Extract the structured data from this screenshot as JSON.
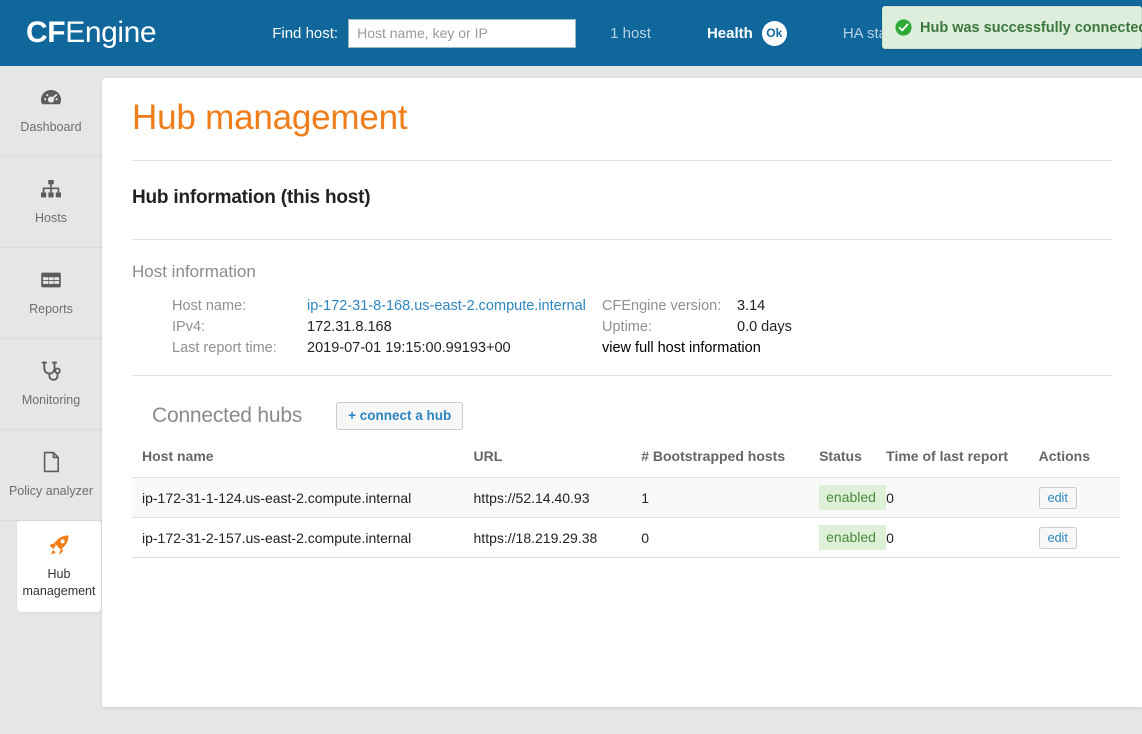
{
  "header": {
    "logo_bold": "CF",
    "logo_light": "Engine",
    "find_host_label": "Find host:",
    "find_host_placeholder": "Host name, key or IP",
    "find_host_value": "",
    "host_count": "1 host",
    "health_label": "Health",
    "health_status": "Ok",
    "ha_status_label": "HA status",
    "brand_color": "#10679c"
  },
  "notification": {
    "text": "Hub was successfully connected",
    "icon": "check-circle-icon",
    "bg_color": "#ddeedd",
    "text_color": "#3c763d"
  },
  "sidebar": {
    "items": [
      {
        "label": "Dashboard",
        "icon": "dashboard-gauge-icon",
        "active": false
      },
      {
        "label": "Hosts",
        "icon": "sitemap-icon",
        "active": false
      },
      {
        "label": "Reports",
        "icon": "table-grid-icon",
        "active": false
      },
      {
        "label": "Monitoring",
        "icon": "stethoscope-icon",
        "active": false
      },
      {
        "label": "Policy analyzer",
        "icon": "file-document-icon",
        "active": false
      },
      {
        "label": "Hub management",
        "icon": "rocket-icon",
        "active": true
      }
    ]
  },
  "main": {
    "page_title": "Hub management",
    "section_title": "Hub information (this host)",
    "host_information": {
      "subsection_title": "Host information",
      "left": [
        {
          "key": "Host name:",
          "value": "ip-172-31-8-168.us-east-2.compute.internal",
          "is_link": true
        },
        {
          "key": "IPv4:",
          "value": "172.31.8.168",
          "is_link": false
        },
        {
          "key": "Last report time:",
          "value": "2019-07-01 19:15:00.99193+00",
          "is_link": false
        }
      ],
      "right": [
        {
          "key": "CFEngine version:",
          "value": "3.14",
          "is_link": false
        },
        {
          "key": "Uptime:",
          "value": "0.0 days",
          "is_link": false
        }
      ],
      "full_info_link": "view full host information"
    },
    "connected_hubs": {
      "title": "Connected hubs",
      "connect_button": "+ connect a hub",
      "columns": [
        "Host name",
        "URL",
        "# Bootstrapped hosts",
        "Status",
        "Time of last report",
        "Actions"
      ],
      "rows": [
        {
          "host_name": "ip-172-31-1-124.us-east-2.compute.internal",
          "url": "https://52.14.40.93",
          "bootstrapped_hosts": "1",
          "status": "enabled",
          "time_of_last_report": "0",
          "action": "edit"
        },
        {
          "host_name": "ip-172-31-2-157.us-east-2.compute.internal",
          "url": "https://18.219.29.38",
          "bootstrapped_hosts": "0",
          "status": "enabled",
          "time_of_last_report": "0",
          "action": "edit"
        }
      ]
    }
  }
}
